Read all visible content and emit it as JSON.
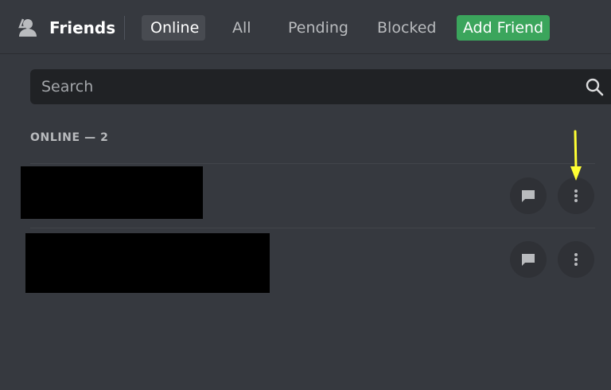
{
  "header": {
    "title": "Friends",
    "tabs": {
      "online": "Online",
      "all": "All",
      "pending": "Pending",
      "blocked": "Blocked",
      "add_friend": "Add Friend"
    }
  },
  "search": {
    "placeholder": "Search"
  },
  "section": {
    "label": "ONLINE — 2"
  },
  "colors": {
    "background": "#36393f",
    "accent_green": "#3ba55c",
    "search_bg": "#202225",
    "annotation_arrow": "#ffff33"
  },
  "icons": {
    "header": "friends-icon",
    "search": "search-icon",
    "message": "message-icon",
    "more": "more-options-icon"
  }
}
